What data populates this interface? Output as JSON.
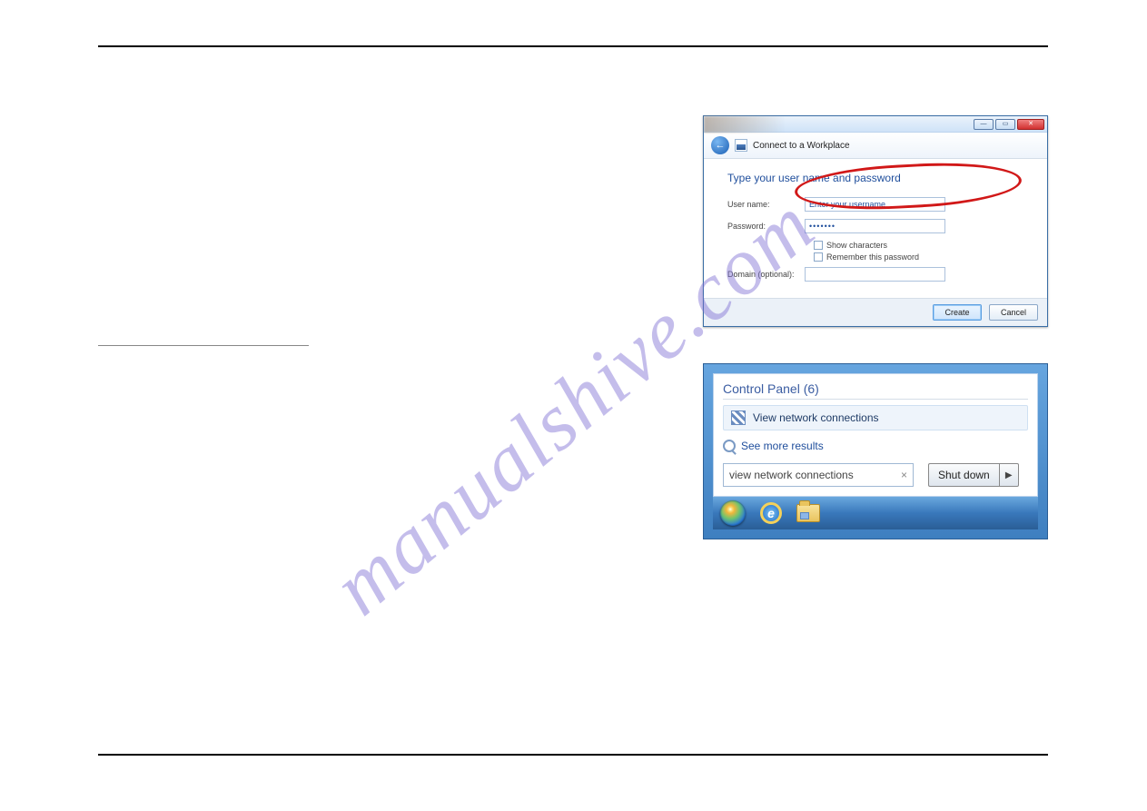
{
  "watermark": "manualshive.com",
  "dialog1": {
    "window_title": "Connect to a Workplace",
    "heading": "Type your user name and password",
    "username_label": "User name:",
    "username_value": "Enter your username",
    "password_label": "Password:",
    "password_value": "•••••••",
    "show_chars_label": "Show characters",
    "remember_label": "Remember this password",
    "domain_label": "Domain (optional):",
    "domain_value": "",
    "create_btn": "Create",
    "cancel_btn": "Cancel",
    "minimize": "—",
    "maximize": "▭",
    "close": "✕",
    "back_glyph": "←"
  },
  "startmenu": {
    "cp_header": "Control Panel (6)",
    "result_item": "View network connections",
    "see_more": "See more results",
    "search_value": "view network connections",
    "clear_glyph": "×",
    "shutdown_label": "Shut down",
    "shutdown_arrow": "▶"
  }
}
